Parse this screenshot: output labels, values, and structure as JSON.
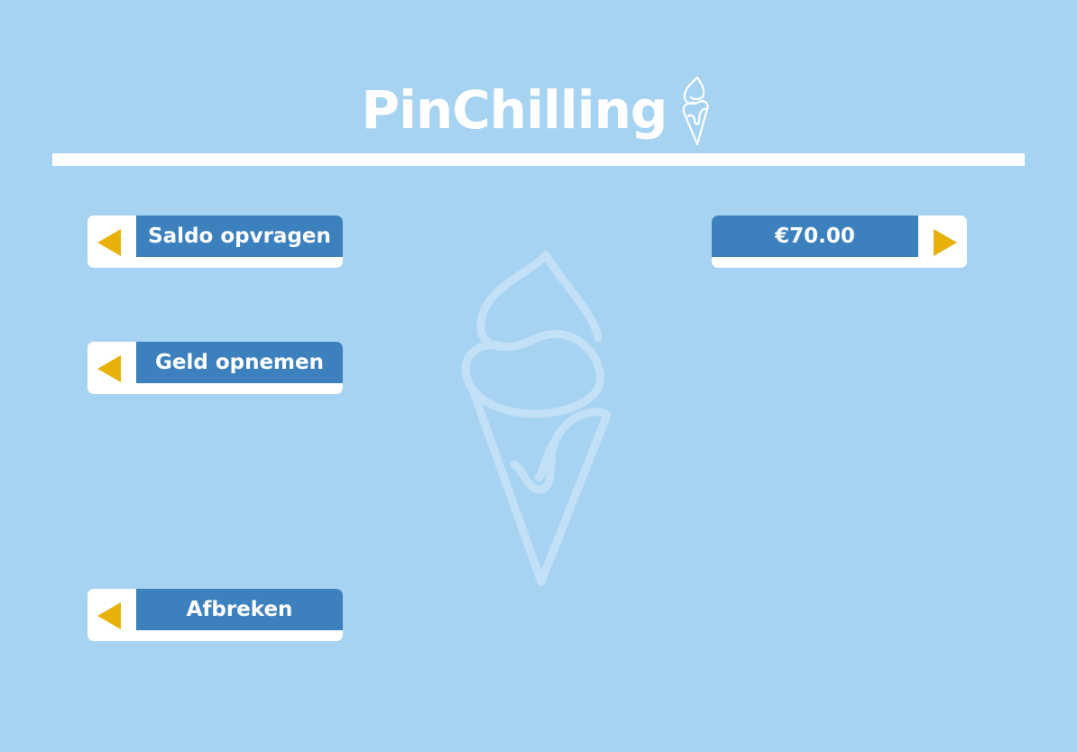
{
  "app": {
    "title": "PinChilling",
    "logo_icon": "ice-cream-cone-icon"
  },
  "menu": {
    "balance_label": "Saldo opvragen",
    "withdraw_label": "Geld opnemen",
    "cancel_label": "Afbreken"
  },
  "balance": {
    "amount": "€70.00"
  },
  "colors": {
    "background": "#a7d3f2",
    "button_blue": "#3c81bd",
    "arrow_yellow": "#e7b108",
    "white": "#ffffff"
  },
  "icons": {
    "left_arrow": "triangle-left-icon",
    "right_arrow": "triangle-right-icon",
    "watermark": "ice-cream-cone-icon"
  }
}
